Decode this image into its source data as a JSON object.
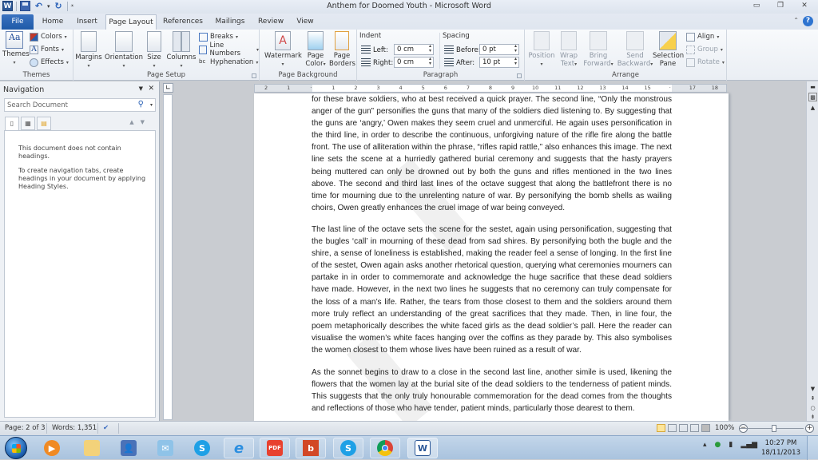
{
  "window": {
    "title": "Anthem for Doomed Youth  -  Microsoft Word",
    "qat": [
      "word-icon",
      "save-icon",
      "undo-icon",
      "redo-icon",
      "customize-qat-icon"
    ]
  },
  "tabs": [
    {
      "label": "File"
    },
    {
      "label": "Home"
    },
    {
      "label": "Insert"
    },
    {
      "label": "Page Layout",
      "active": true
    },
    {
      "label": "References"
    },
    {
      "label": "Mailings"
    },
    {
      "label": "Review"
    },
    {
      "label": "View"
    }
  ],
  "ribbon": {
    "themes": {
      "group_label": "Themes",
      "themes_btn": "Themes",
      "colors": "Colors",
      "fonts": "Fonts",
      "effects": "Effects"
    },
    "page_setup": {
      "group_label": "Page Setup",
      "margins": "Margins",
      "orientation": "Orientation",
      "size": "Size",
      "columns": "Columns",
      "breaks": "Breaks",
      "line_numbers": "Line Numbers",
      "hyphenation": "Hyphenation"
    },
    "page_background": {
      "group_label": "Page Background",
      "watermark": "Watermark",
      "page_color_1": "Page",
      "page_color_2": "Color",
      "page_borders_1": "Page",
      "page_borders_2": "Borders"
    },
    "paragraph": {
      "group_label": "Paragraph",
      "indent_title": "Indent",
      "left_label": "Left:",
      "left_value": "0 cm",
      "right_label": "Right:",
      "right_value": "0 cm",
      "spacing_title": "Spacing",
      "before_label": "Before:",
      "before_value": "0 pt",
      "after_label": "After:",
      "after_value": "10 pt"
    },
    "arrange": {
      "group_label": "Arrange",
      "position": "Position",
      "wrap_1": "Wrap",
      "wrap_2": "Text",
      "bring_1": "Bring",
      "bring_2": "Forward",
      "send_1": "Send",
      "send_2": "Backward",
      "selection_1": "Selection",
      "selection_2": "Pane",
      "align": "Align",
      "group": "Group",
      "rotate": "Rotate"
    }
  },
  "navigation": {
    "title": "Navigation",
    "search_placeholder": "Search Document",
    "message_1": "This document does not contain headings.",
    "message_2": "To create navigation tabs, create headings in your document by applying Heading Styles."
  },
  "ruler": {
    "labels": [
      "2",
      "1",
      "",
      "1",
      "2",
      "3",
      "4",
      "5",
      "6",
      "7",
      "8",
      "9",
      "10",
      "11",
      "12",
      "13",
      "14",
      "15",
      "",
      "17",
      "18"
    ]
  },
  "document": {
    "paragraphs": [
      "for these brave soldiers, who at best received a quick prayer. The second line, “Only the monstrous anger of the gun” personifies the guns that many of the soldiers died listening to. By suggesting that the guns are ‘angry,’ Owen makes they seem cruel and unmerciful. He again uses personification in the third line, in order to describe the continuous, unforgiving nature of the rifle fire along the battle front. The use of alliteration within the phrase, “rifles rapid rattle,” also enhances this image. The next line sets the scene at a hurriedly gathered burial ceremony and suggests that the hasty prayers being muttered can only be drowned out by both the guns and rifles mentioned in the two lines above. The second and third last lines of the octave suggest that along the battlefront there is no time for mourning due to the unrelenting nature of war. By personifying the bomb shells as wailing choirs, Owen greatly enhances the cruel image of war being conveyed.",
      "The last line of the octave sets the scene for the sestet, again using personification, suggesting that the bugles ‘call’ in mourning of these dead from sad shires. By personifying both the bugle and the shire, a sense of loneliness is established, making the reader feel a sense of longing. In the first line of the sestet, Owen again asks another rhetorical question, querying what ceremonies mourners can partake in in order to commemorate and acknowledge the huge sacrifice that these dead soldiers have made. However, in the next two lines he suggests that no ceremony can truly compensate for the loss of a man’s life. Rather, the tears from those closest to them and the soldiers around them more truly reflect an understanding of the great sacrifices that they made. Then, in line four, the poem metaphorically describes the white faced girls as the dead soldier’s pall. Here the reader can visualise the women’s white faces hanging over the coffins as they parade by. This also symbolises the women closest to them whose lives have been ruined as a result of war.",
      "As the sonnet begins to draw to a close in the second last line, another simile is used, likening the flowers that the women lay at the burial site of the dead soldiers to the tenderness of patient minds. This suggests that the only truly honourable commemoration for the dead comes from the thoughts and reflections of those who have tender, patient minds, particularly those dearest to them."
    ]
  },
  "status": {
    "page": "Page: 2 of 3",
    "words": "Words: 1,351",
    "zoom": "100%",
    "zoom_level_percent": 100
  },
  "taskbar": {
    "apps": [
      "windows-media-player",
      "windows-explorer",
      "user-accounts",
      "windows-live-mail",
      "skype",
      "internet-explorer",
      "pdf-app",
      "bing",
      "skype",
      "google-chrome",
      "microsoft-word"
    ],
    "time": "10:27 PM",
    "date": "18/11/2013"
  }
}
